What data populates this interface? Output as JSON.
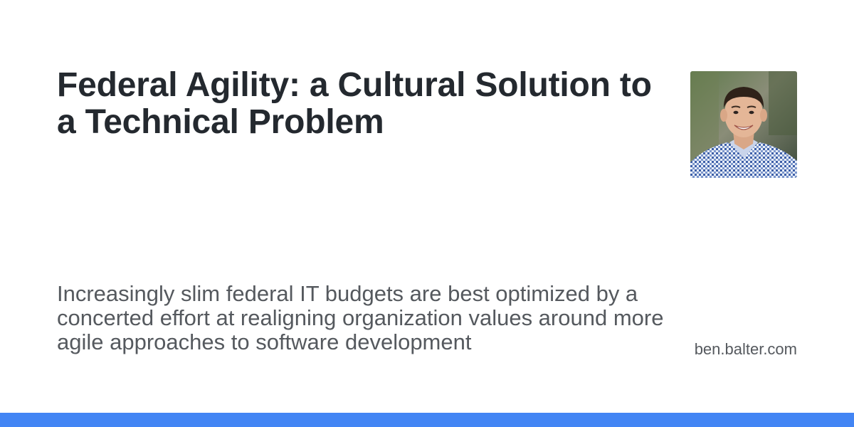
{
  "card": {
    "title": "Federal Agility: a Cultural Solution to a Technical Problem",
    "description": "Increasingly slim federal IT budgets are best optimized by a concerted effort at realigning organization values around more agile approaches to software development",
    "site": "ben.balter.com",
    "avatar_icon": "author-photo",
    "accent_color": "#4285f4",
    "title_color": "#24292f",
    "text_color": "#55595e"
  }
}
